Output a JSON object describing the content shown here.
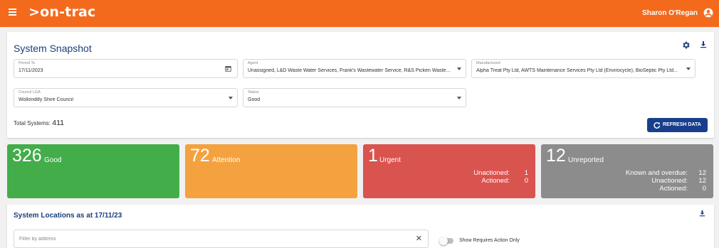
{
  "header": {
    "logo": ">on-trac",
    "user_name": "Sharon O'Regan",
    "accent": "#f46a1d"
  },
  "snapshot": {
    "title": "System Snapshot",
    "icons": [
      "gear-icon",
      "download-icon"
    ],
    "fields": {
      "period_to": {
        "label": "Period To",
        "value": "17/11/2023"
      },
      "agent": {
        "label": "Agent",
        "value": "Unassigned, L&D Waste Water Services, Frank's Wastewater Service, R&S Picken Waste..."
      },
      "manufactured": {
        "label": "Manufactured",
        "value": "Alpha Treat Pty Ltd, AWTS Maintenance Services Pty Ltd (Envirocycle), BioSeptic Pty Ltd..."
      },
      "council_lga": {
        "label": "Council LGA",
        "value": "Wollondilly Shire Council"
      },
      "status": {
        "label": "Status",
        "value": "Good"
      }
    },
    "total_label": "Total Systems:",
    "total_value": "411",
    "refresh_label": "REFRESH DATA",
    "refresh_color": "#193f8c"
  },
  "tiles": {
    "good": {
      "count": "326",
      "label": "Good",
      "color": "#43ad4a"
    },
    "attention": {
      "count": "72",
      "label": "Attention",
      "color": "#f4a240"
    },
    "urgent": {
      "count": "1",
      "label": "Urgent",
      "color": "#d9534f",
      "rows": [
        {
          "key": "Unactioned:",
          "value": "1"
        },
        {
          "key": "Actioned:",
          "value": "0"
        }
      ]
    },
    "unreported": {
      "count": "12",
      "label": "Unreported",
      "color": "#8c8c8c",
      "rows": [
        {
          "key": "Known and overdue:",
          "value": "12"
        },
        {
          "key": "Unactioned:",
          "value": "12"
        },
        {
          "key": "Actioned:",
          "value": "0"
        }
      ]
    }
  },
  "locations": {
    "title": "System Locations as at 17/11/23",
    "filter_placeholder": "Filter by address",
    "clear_glyph": "✕",
    "toggle_label": "Show Requires Action Only",
    "toggle_on": false
  }
}
